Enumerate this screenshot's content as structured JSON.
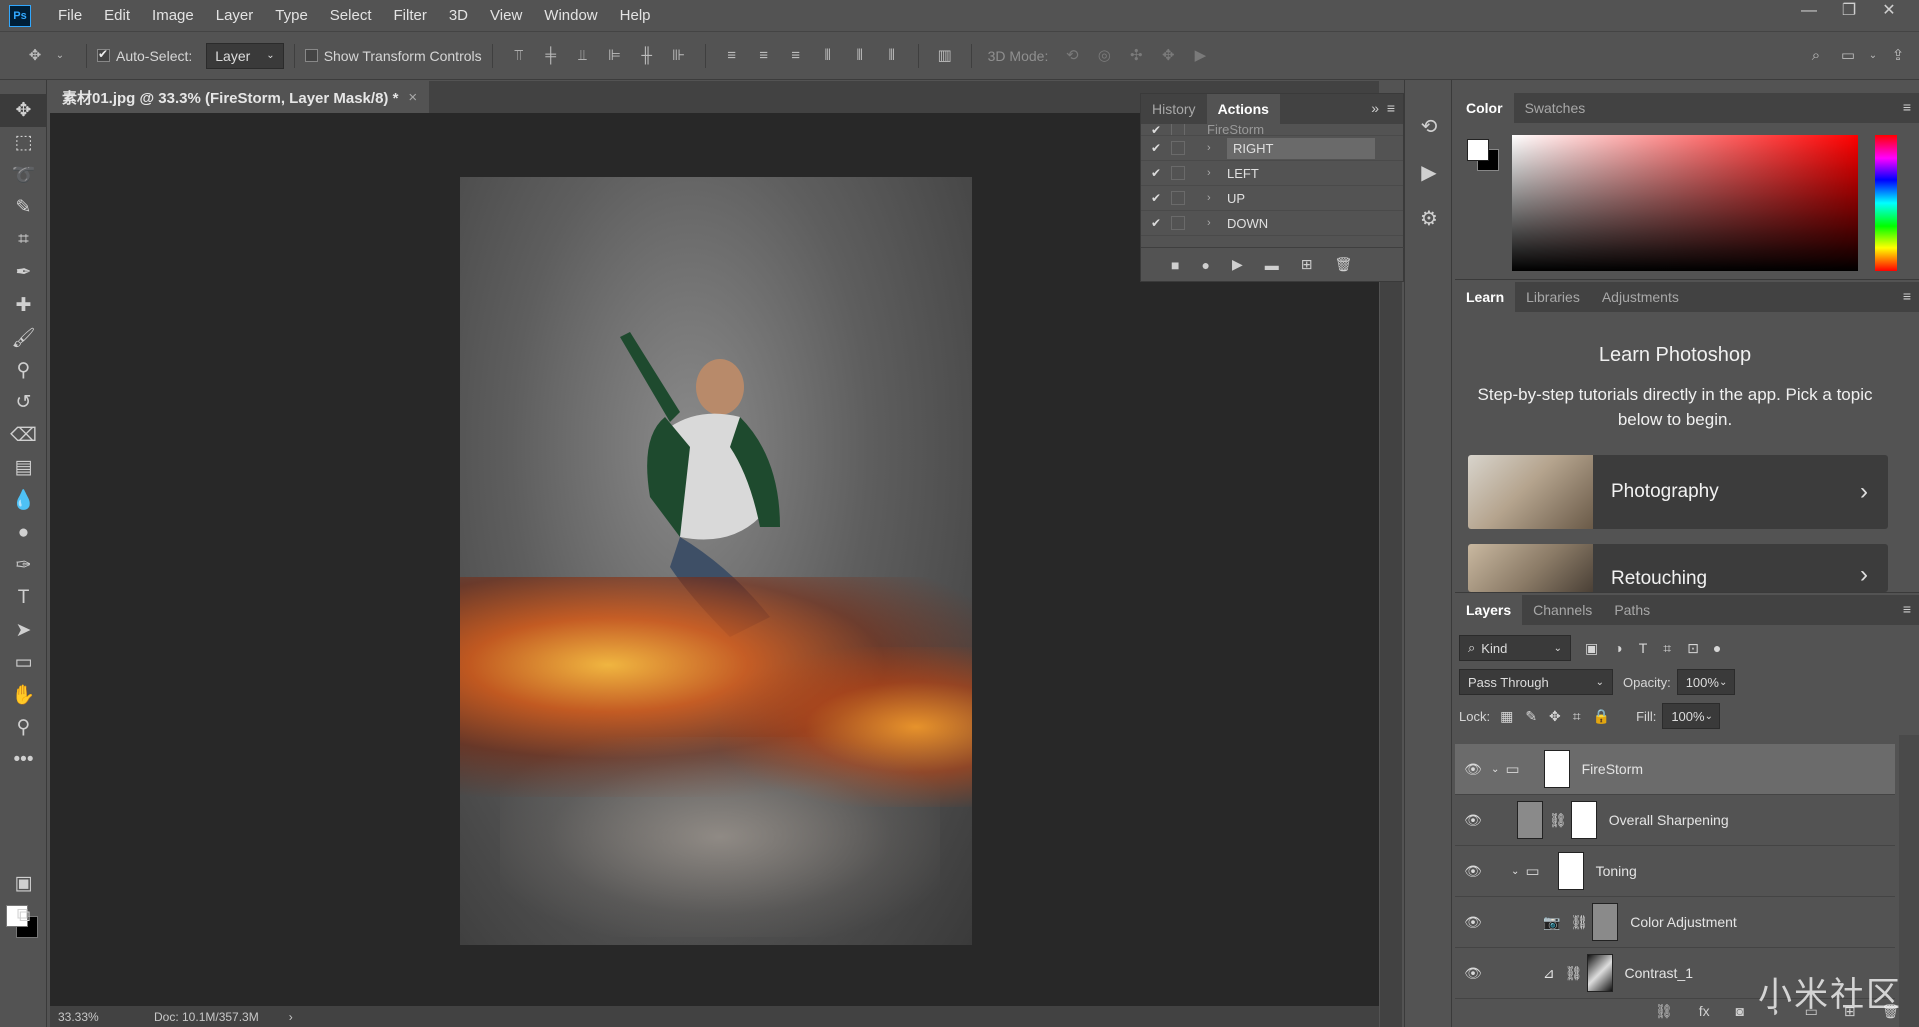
{
  "app": {
    "logo": "Ps"
  },
  "menu": [
    "File",
    "Edit",
    "Image",
    "Layer",
    "Type",
    "Select",
    "Filter",
    "3D",
    "View",
    "Window",
    "Help"
  ],
  "window_controls": {
    "minimize": "—",
    "restore": "❐",
    "close": "✕"
  },
  "options": {
    "auto_select_label": "Auto-Select:",
    "auto_select_value": "Layer",
    "transform_label": "Show Transform Controls",
    "mode_3d_label": "3D Mode:"
  },
  "document": {
    "tab_title": "素材01.jpg @ 33.3% (FireStorm, Layer Mask/8) *",
    "close": "×",
    "zoom": "33.33%",
    "doc_info": "Doc: 10.1M/357.3M",
    "status_arrow": "›"
  },
  "actions_panel": {
    "tabs": [
      "History",
      "Actions"
    ],
    "active_tab": "Actions",
    "partial_row": "FireStorm",
    "rows": [
      {
        "name": "RIGHT",
        "checked": true,
        "selected": true
      },
      {
        "name": "LEFT",
        "checked": true,
        "selected": false
      },
      {
        "name": "UP",
        "checked": true,
        "selected": false
      },
      {
        "name": "DOWN",
        "checked": true,
        "selected": false
      }
    ]
  },
  "color_panel": {
    "tabs": [
      "Color",
      "Swatches"
    ],
    "active_tab": "Color"
  },
  "learn_panel": {
    "tabs": [
      "Learn",
      "Libraries",
      "Adjustments"
    ],
    "active_tab": "Learn",
    "title": "Learn Photoshop",
    "description": "Step-by-step tutorials directly in the app. Pick a topic below to begin.",
    "cards": [
      "Photography",
      "Retouching"
    ]
  },
  "layers_panel": {
    "tabs": [
      "Layers",
      "Channels",
      "Paths"
    ],
    "active_tab": "Layers",
    "filter_kind": "Kind",
    "blend_mode": "Pass Through",
    "opacity_label": "Opacity:",
    "opacity_value": "100%",
    "lock_label": "Lock:",
    "fill_label": "Fill:",
    "fill_value": "100%",
    "layers": [
      {
        "name": "FireStorm",
        "type": "group",
        "selected": true
      },
      {
        "name": "Overall Sharpening",
        "type": "layer",
        "selected": false
      },
      {
        "name": "Toning",
        "type": "group",
        "selected": false
      },
      {
        "name": "Color Adjustment",
        "type": "adjustment",
        "selected": false
      },
      {
        "name": "Contrast_1",
        "type": "adjustment",
        "selected": false
      }
    ]
  },
  "watermark": "小米社区",
  "colors": {
    "accent": "#31a8ff",
    "foreground": "#ffffff",
    "background": "#000000"
  }
}
